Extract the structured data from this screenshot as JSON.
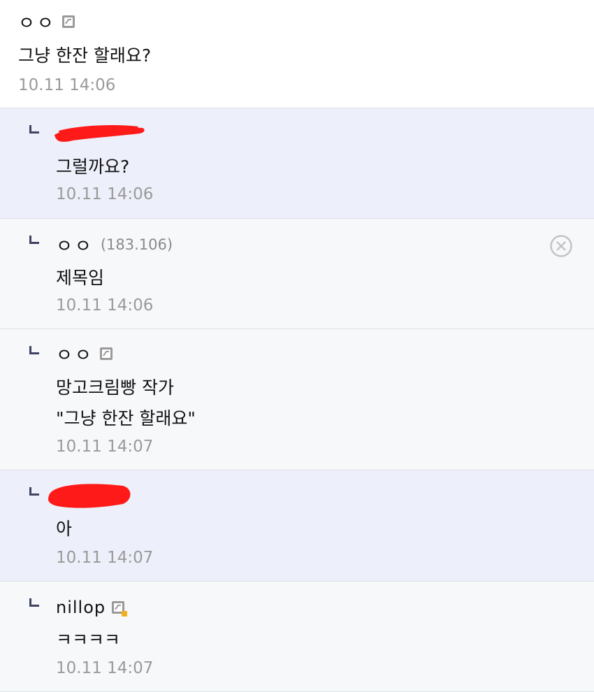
{
  "comments": [
    {
      "nick": "ㅇㅇ",
      "text": "그냥 한잔 할래요?",
      "date": "10.11 14:06"
    },
    {
      "nick": "",
      "text": "그럴까요?",
      "date": "10.11 14:06"
    },
    {
      "nick": "ㅇㅇ",
      "ip": "(183.106)",
      "text": "제목임",
      "date": "10.11 14:06"
    },
    {
      "nick": "ㅇㅇ",
      "text": "망고크림빵 작가\n\"그냥 한잔 할래요\"",
      "date": "10.11 14:07"
    },
    {
      "nick": "",
      "text": "아",
      "date": "10.11 14:07"
    },
    {
      "nick": "nillop",
      "text": "ㅋㅋㅋㅋ",
      "date": "10.11 14:07"
    }
  ],
  "colors": {
    "highlight_bg": "#edf0fa",
    "plain_bg": "#f7f8fa",
    "redaction": "#ff1a1a",
    "reply_marker": "#3e4461"
  },
  "icons": [
    "gallery-user-icon",
    "reply-arrow-icon",
    "delete-circle-icon",
    "nick-con-icon"
  ]
}
